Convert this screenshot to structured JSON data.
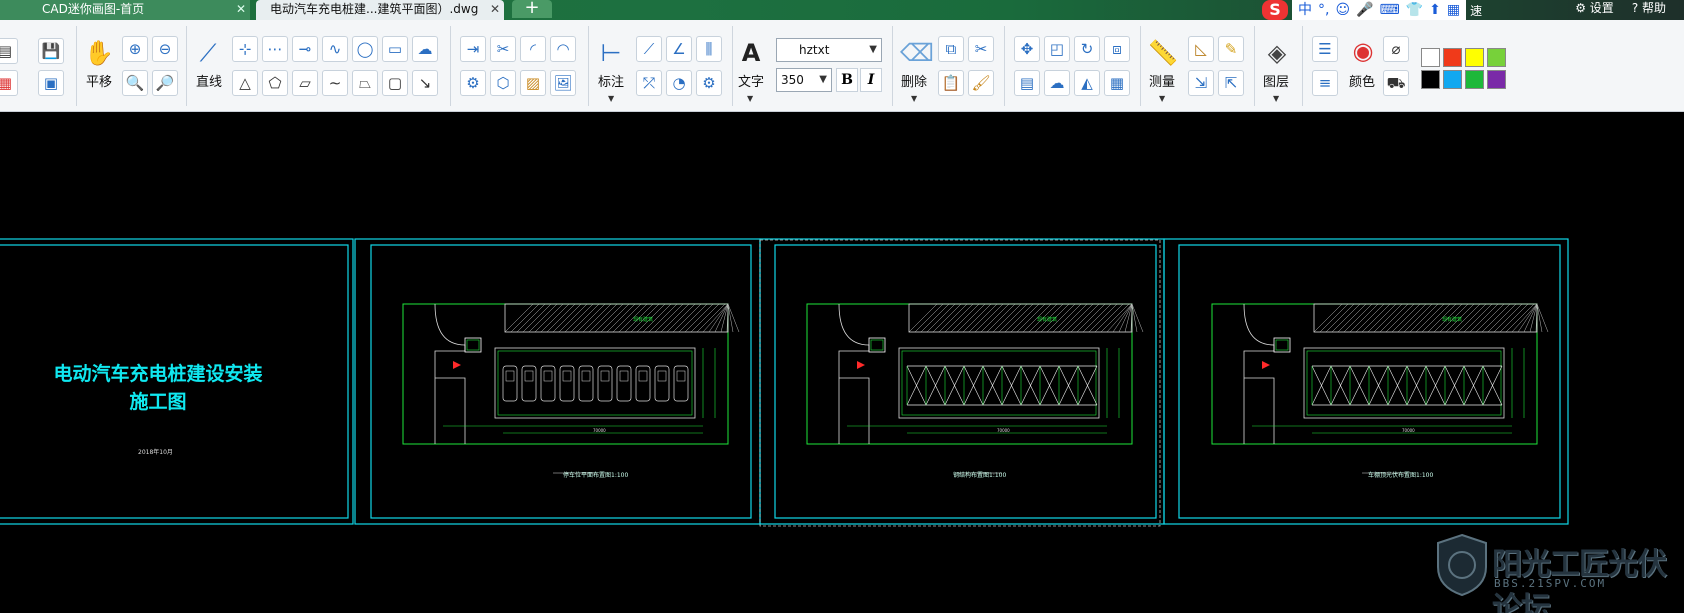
{
  "tabs": [
    {
      "label": "CAD迷你画图-首页",
      "close": "✕"
    },
    {
      "label": "电动汽车充电桩建...建筑平面图）.dwg",
      "close": "✕"
    }
  ],
  "new_tab": "+",
  "ime": {
    "logo": "S",
    "items": [
      "中",
      "°,",
      "☺",
      "🎤",
      "⌨",
      "👕",
      "⬆",
      "▦"
    ],
    "tail": "速"
  },
  "top_right": {
    "settings": "⚙ 设置",
    "help": "? 帮助"
  },
  "toolbar": {
    "pan": "平移",
    "line": "直线",
    "dimension": "标注",
    "text": "文字",
    "font": "hztxt",
    "font_size": "350",
    "bold": "B",
    "italic": "I",
    "delete": "删除",
    "measure": "测量",
    "layer": "图层",
    "color": "颜色",
    "swatches": [
      "#ffffff",
      "#f03a1a",
      "#ffff00",
      "#77d13a",
      "#000000",
      "#12a8f0",
      "#1db83a",
      "#7a2aa8"
    ]
  },
  "drawing": {
    "cover_title_1": "电动汽车充电桩建设安装",
    "cover_title_2": "施工图",
    "cover_date": "2018年10月",
    "hatch_label": "现有建筑",
    "caption_1": "停车位平面布置图1:100",
    "caption_2": "钢结构布置图1:100",
    "caption_3": "车棚顶光伏布置图1:100",
    "dim_total": "70000"
  },
  "watermark": {
    "title": "阳光工匠光伏论坛",
    "url": "BBS.21SPV.COM"
  }
}
